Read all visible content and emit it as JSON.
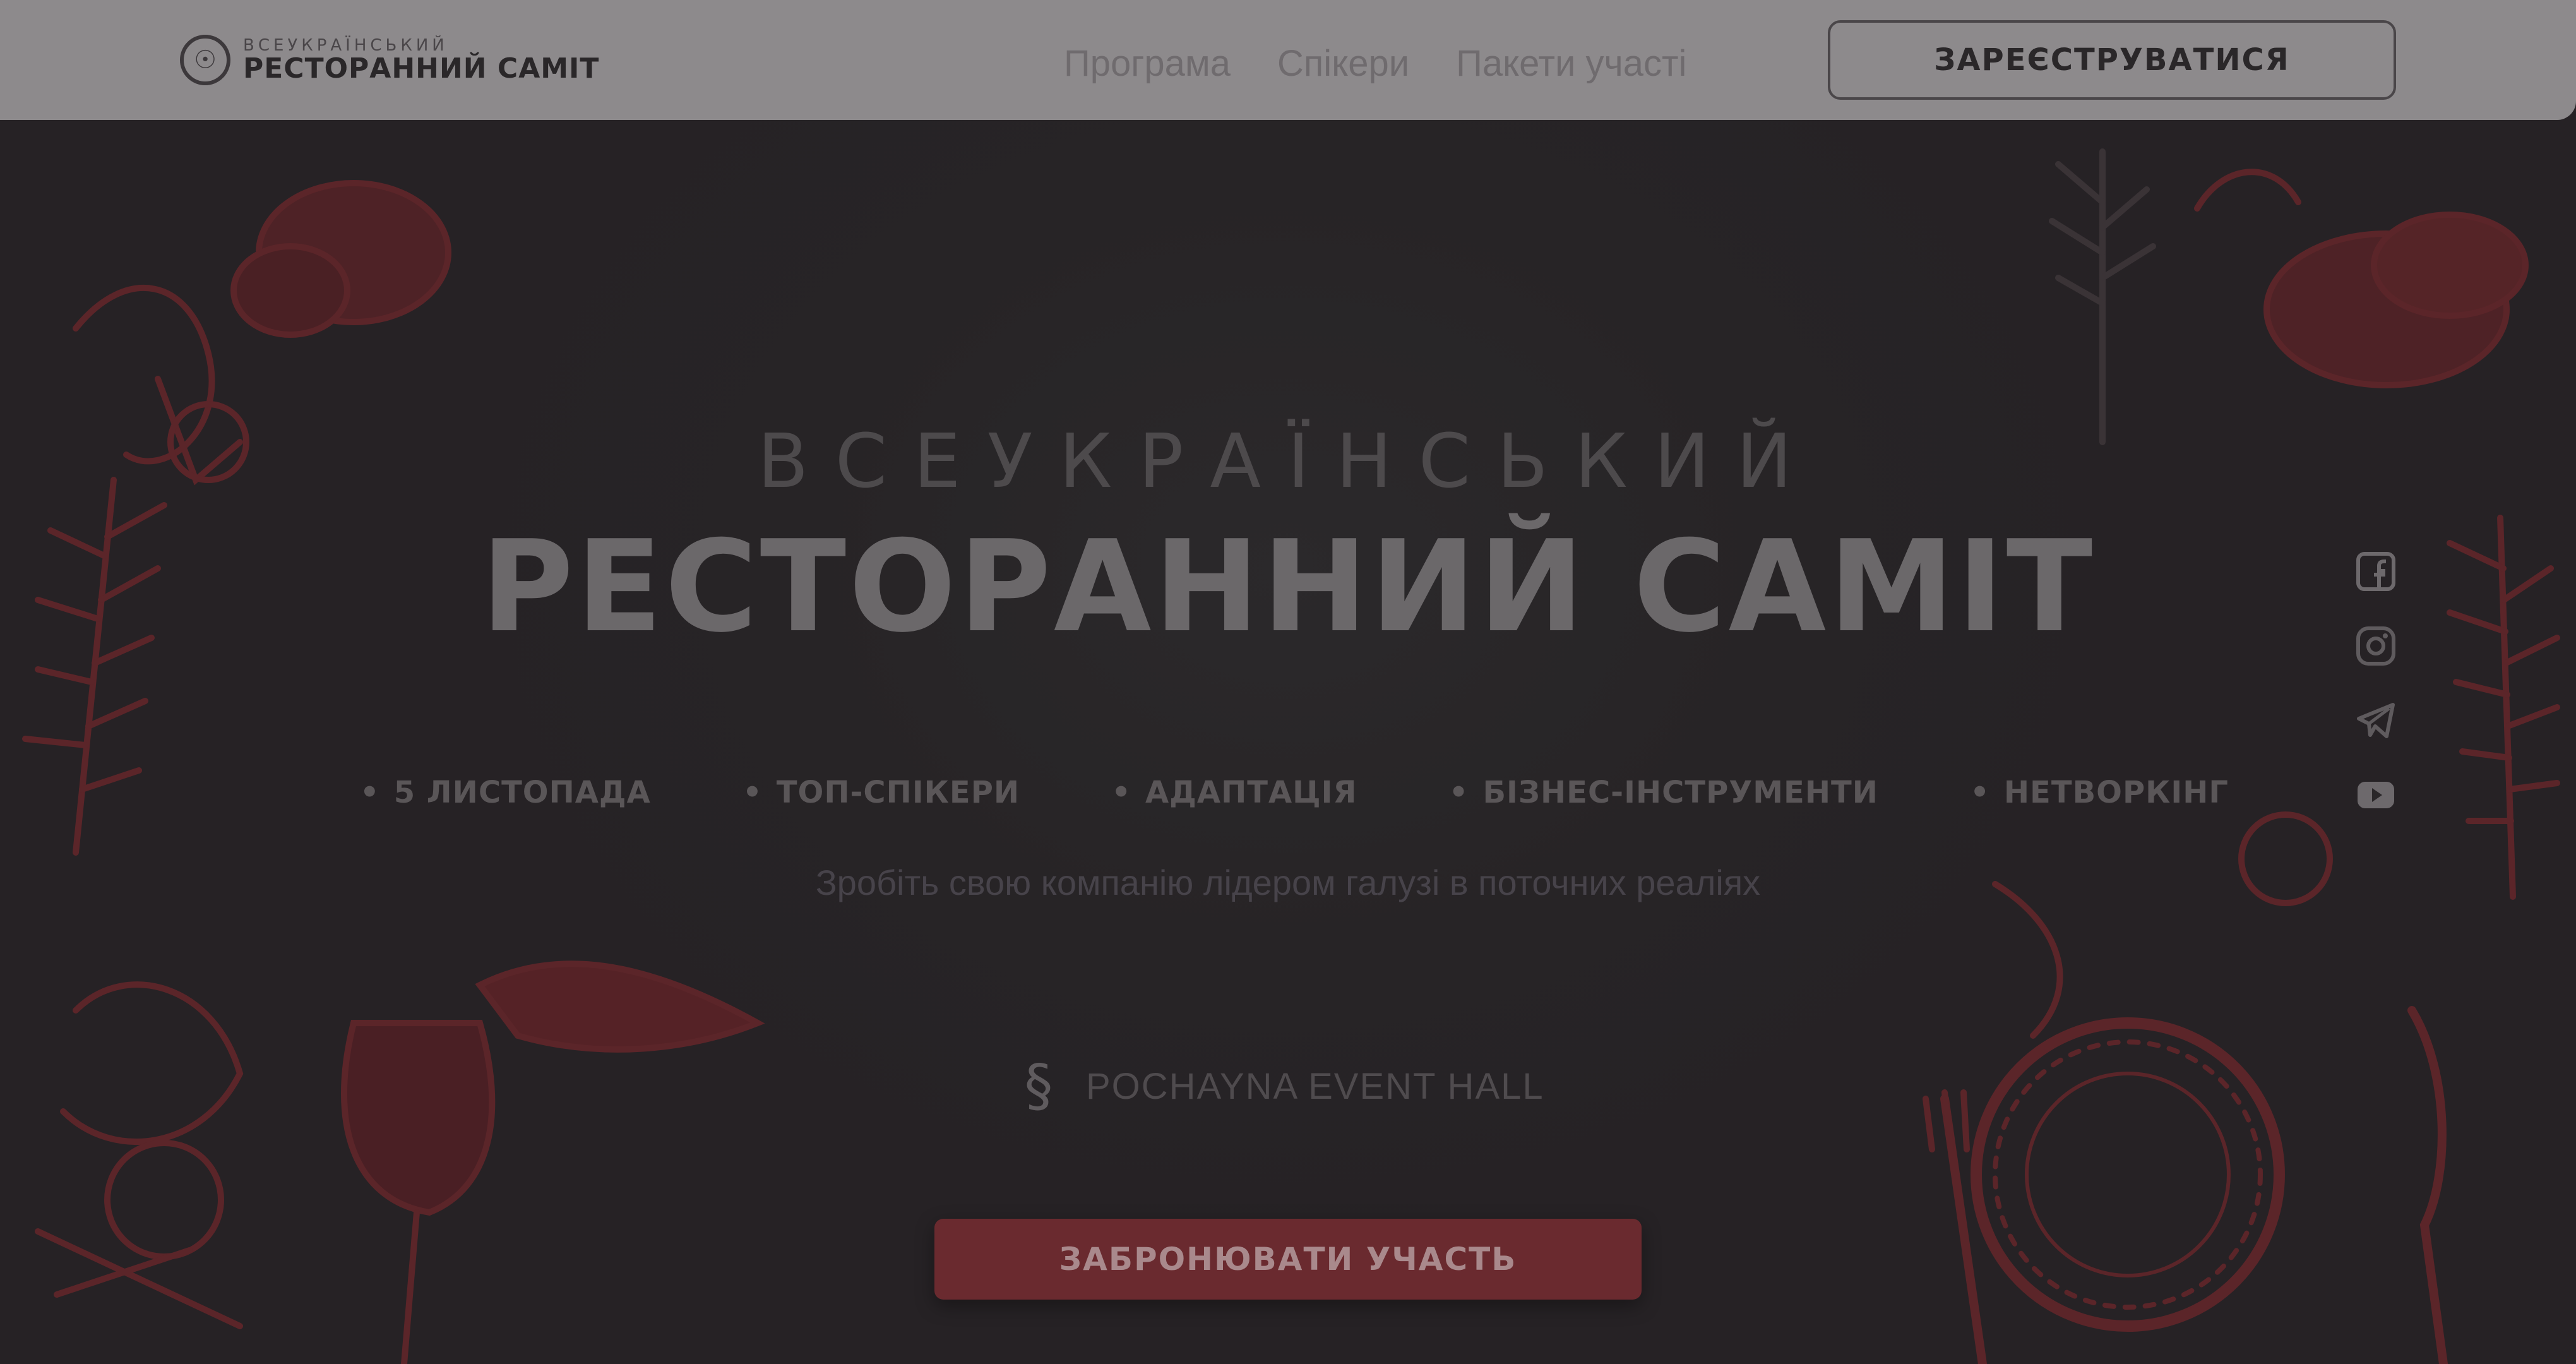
{
  "header": {
    "logo_subtitle": "ВСЕУКРАЇНСЬКИЙ",
    "logo_title": "РЕСТОРАННИЙ САМІТ",
    "nav": [
      {
        "label": "Програма"
      },
      {
        "label": "Спікери"
      },
      {
        "label": "Пакети участі"
      }
    ],
    "register_label": "ЗАРЕЄСТРУВАТИСЯ"
  },
  "hero": {
    "subtitle": "ВСЕУКРАЇНСЬКИЙ",
    "title": "РЕСТОРАННИЙ САМІТ",
    "features": [
      {
        "label": "5 ЛИСТОПАДА"
      },
      {
        "label": "ТОП-СПІКЕРИ"
      },
      {
        "label": "АДАПТАЦІЯ"
      },
      {
        "label": "БІЗНЕС-ІНСТРУМЕНТИ"
      },
      {
        "label": "НЕТВОРКІНГ"
      }
    ],
    "tagline": "Зробіть свою компанію лідером галузі в поточних реаліях",
    "venue": "POCHAYNA EVENT HALL",
    "book_label": "ЗАБРОНЮВАТИ УЧАСТЬ"
  },
  "social": [
    "facebook-icon",
    "instagram-icon",
    "telegram-icon",
    "youtube-icon"
  ],
  "colors": {
    "background": "#262325",
    "header": "#8d8a8c",
    "accent": "#6a2a2f",
    "illustration": "#5a2428"
  }
}
